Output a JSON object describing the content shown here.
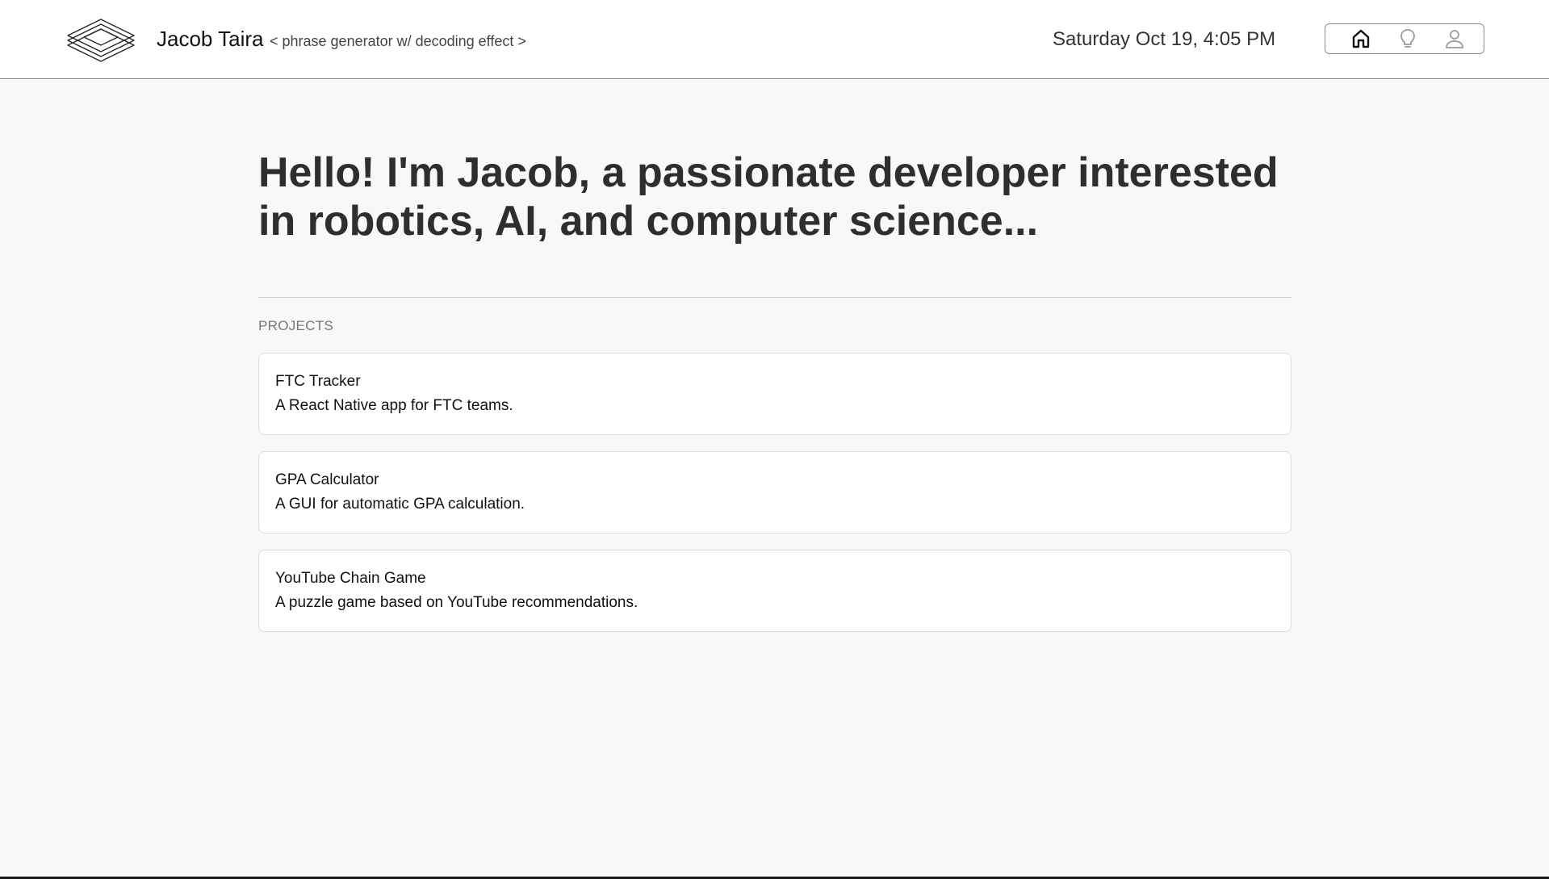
{
  "header": {
    "name": "Jacob Taira",
    "tagline": "< phrase generator w/ decoding effect >",
    "datetime": "Saturday Oct 19, 4:05 PM",
    "logo_icon": "stacked-layers-icon",
    "nav": [
      {
        "icon": "home-icon",
        "active": true
      },
      {
        "icon": "lightbulb-icon",
        "active": false
      },
      {
        "icon": "user-icon",
        "active": false
      }
    ]
  },
  "main": {
    "headline": "Hello! I'm Jacob, a passionate developer interested in robotics, AI, and computer science...",
    "projects_label": "PROJECTS",
    "projects": [
      {
        "title": "FTC Tracker",
        "description": "A React Native app for FTC teams."
      },
      {
        "title": "GPA Calculator",
        "description": "A GUI for automatic GPA calculation."
      },
      {
        "title": "YouTube Chain Game",
        "description": "A puzzle game based on YouTube recommendations."
      }
    ]
  },
  "colors": {
    "background": "#f7f8fa",
    "header_background": "#ffffff",
    "headline_text": "#2e2e2e",
    "card_border": "#dcdcdc",
    "label_text": "#777777"
  }
}
